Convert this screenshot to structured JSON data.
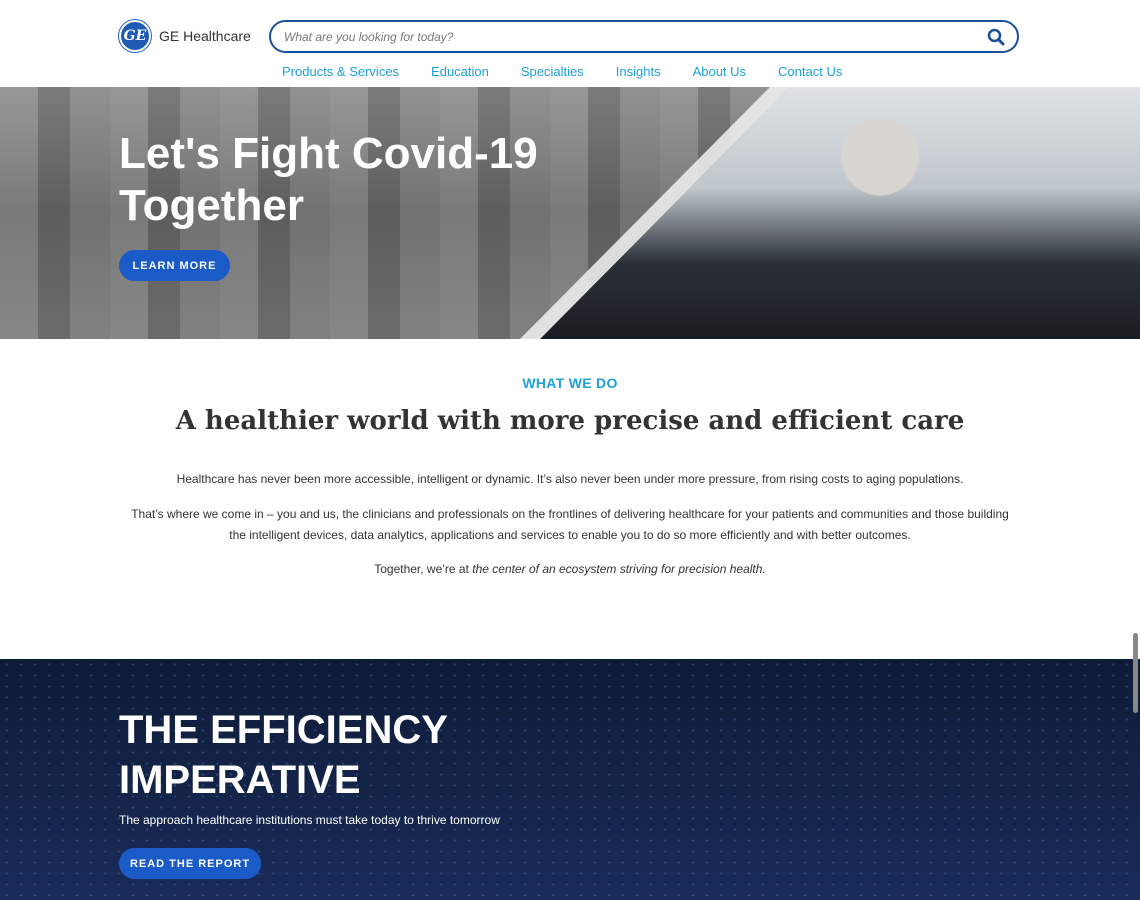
{
  "header": {
    "logo_mark": "GE",
    "logo_text": "GE Healthcare",
    "search_placeholder": "What are you looking for today?",
    "nav": [
      "Products & Services",
      "Education",
      "Specialties",
      "Insights",
      "About Us",
      "Contact Us"
    ]
  },
  "hero": {
    "title": "Let's Fight Covid-19 Together",
    "button": "LEARN MORE"
  },
  "what_we_do": {
    "label": "WHAT WE DO",
    "title": "A healthier world with more precise and efficient care",
    "p1": "Healthcare has never been more accessible, intelligent or dynamic. It’s also never been under more pressure, from rising costs to aging populations.",
    "p2": "That’s where we come in – you and us, the clinicians and professionals on the frontlines of delivering healthcare for your patients and communities and those building the intelligent devices, data analytics, applications and services to enable you to do so more efficiently and with better outcomes.",
    "p3_prefix": "Together, we’re at ",
    "p3_italic": "the center of an ecosystem striving for precision health."
  },
  "efficiency": {
    "title": "THE EFFICIENCY IMPERATIVE",
    "subtitle": "The approach healthcare institutions must take today to thrive tomorrow",
    "button": "READ THE REPORT"
  },
  "colors": {
    "accent": "#1fa0d6",
    "button": "#1a5bc8",
    "search_border": "#1a4ea0",
    "band_bg": "#14244a"
  },
  "icons": {
    "search": "search-icon",
    "logo": "ge-logo-icon"
  }
}
